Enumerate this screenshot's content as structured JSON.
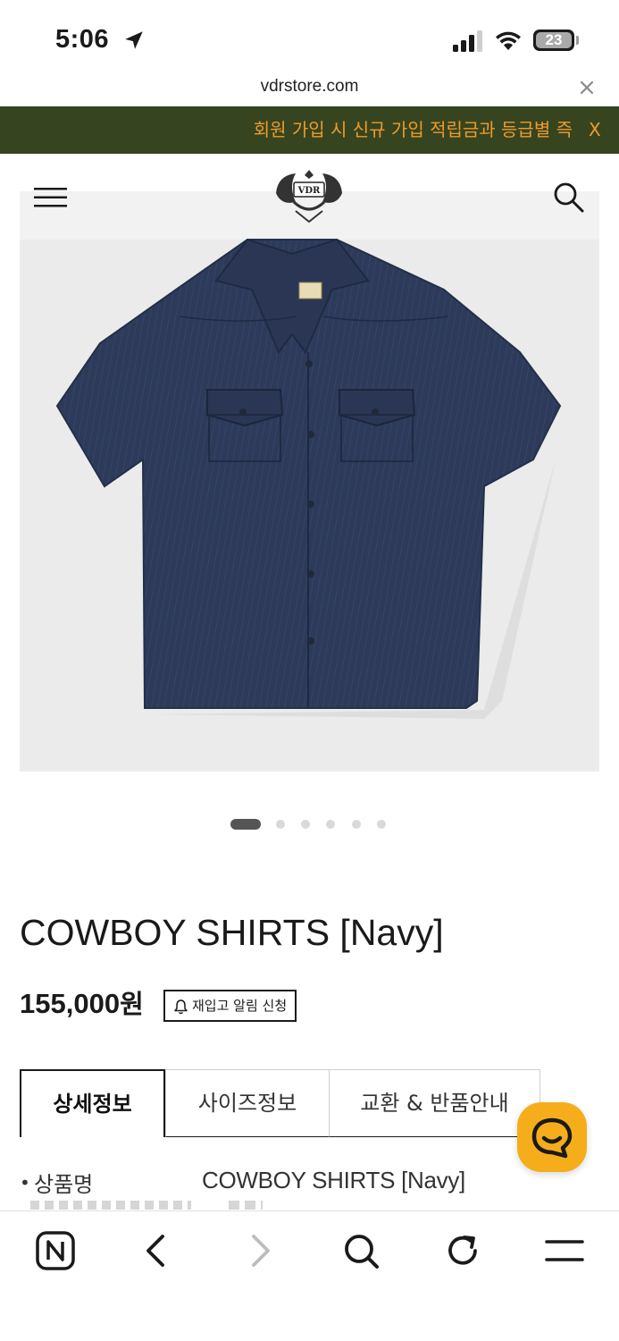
{
  "status_bar": {
    "time": "5:06",
    "battery": "23"
  },
  "browser": {
    "url": "vdrstore.com"
  },
  "promo_banner": {
    "text": "회원 가입 시 신규 가입 적립금과 등급별 즉",
    "close_label": "X"
  },
  "header": {
    "logo_text": "VDR"
  },
  "product": {
    "image_count": 6,
    "active_image": 1,
    "title": "COWBOY SHIRTS [Navy]",
    "price": "155,000",
    "currency": "원",
    "restock_button": "재입고 알림 신청"
  },
  "tabs": [
    {
      "label": "상세정보",
      "active": true
    },
    {
      "label": "사이즈정보",
      "active": false
    },
    {
      "label": "교환 & 반품안내",
      "active": false
    }
  ],
  "details": {
    "rows": [
      {
        "label": "상품명",
        "value": "COWBOY SHIRTS [Navy]"
      }
    ]
  },
  "colors": {
    "promo_bg": "#36451f",
    "promo_text": "#f09a2a",
    "chat_button": "#f5ad1b",
    "shirt": "#2d3a5a"
  },
  "icons": {
    "toolbar": [
      "naver-n-icon",
      "back-arrow-icon",
      "forward-arrow-icon",
      "search-icon",
      "reload-icon",
      "menu-icon"
    ]
  }
}
